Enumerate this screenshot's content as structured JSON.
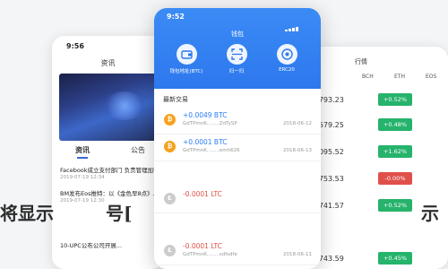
{
  "left_phone": {
    "time": "9:56",
    "nav_title": "资讯",
    "tabs": [
      "资讯",
      "公告"
    ],
    "news": [
      {
        "title": "Facebook成立支付部门 负责管理加密...",
        "date": "2019-07-19 12:34"
      },
      {
        "title": "BM发布Eos推特：以《金色早8点》...",
        "date": "2019-07-19 12:30"
      },
      {
        "title": "10-UPC公布公司开展...",
        "date": ""
      }
    ]
  },
  "center_phone": {
    "time": "9:52",
    "title": "钱包",
    "actions": [
      {
        "label": "钱包地址(BTC)",
        "icon": "wallet-icon"
      },
      {
        "label": "扫一扫",
        "icon": "scan-icon"
      },
      {
        "label": "ERC20",
        "icon": "token-icon"
      }
    ],
    "section_title": "最新交易",
    "transactions": [
      {
        "amount": "+0.0049",
        "unit": "BTC",
        "addr": "GdTPmnK........ZdTySP",
        "time": "2018-06-12",
        "sign": "pos"
      },
      {
        "amount": "+0.0001",
        "unit": "BTC",
        "addr": "GdTPmnK........emh626",
        "time": "2018-06-13",
        "sign": "pos"
      },
      {
        "amount": "-0.0001",
        "unit": "LTC",
        "addr": "",
        "time": "",
        "sign": "neg"
      },
      {
        "amount": "-0.0001",
        "unit": "LTC",
        "addr": "GdTPmnK........sdfsdfe",
        "time": "2018-06-11",
        "sign": "neg"
      }
    ]
  },
  "right_phone": {
    "title": "行情",
    "columns": [
      "BCH",
      "ETH",
      "EOS"
    ],
    "rows": [
      {
        "price": "¥ 38793.23",
        "change": "+0.52%",
        "color": "#26b36b"
      },
      {
        "price": "¥ 39579.25",
        "change": "+0.48%",
        "color": "#26b36b"
      },
      {
        "price": "¥ 39095.52",
        "change": "+1.62%",
        "color": "#26b36b"
      },
      {
        "price": "¥ 38753.53",
        "change": "-0.00%",
        "color": "#e0504a"
      },
      {
        "price": "¥ 39741.57",
        "change": "+0.52%",
        "color": "#26b36b"
      },
      {
        "price": "¥ 38743.59",
        "change": "+0.45%",
        "color": "#26b36b"
      }
    ]
  },
  "watermark": {
    "left": "将显示",
    "middle": "号[",
    "right": "示"
  },
  "colors": {
    "brand_blue": "#2d78ee",
    "positive": "#26b36b",
    "negative": "#e0504a"
  }
}
